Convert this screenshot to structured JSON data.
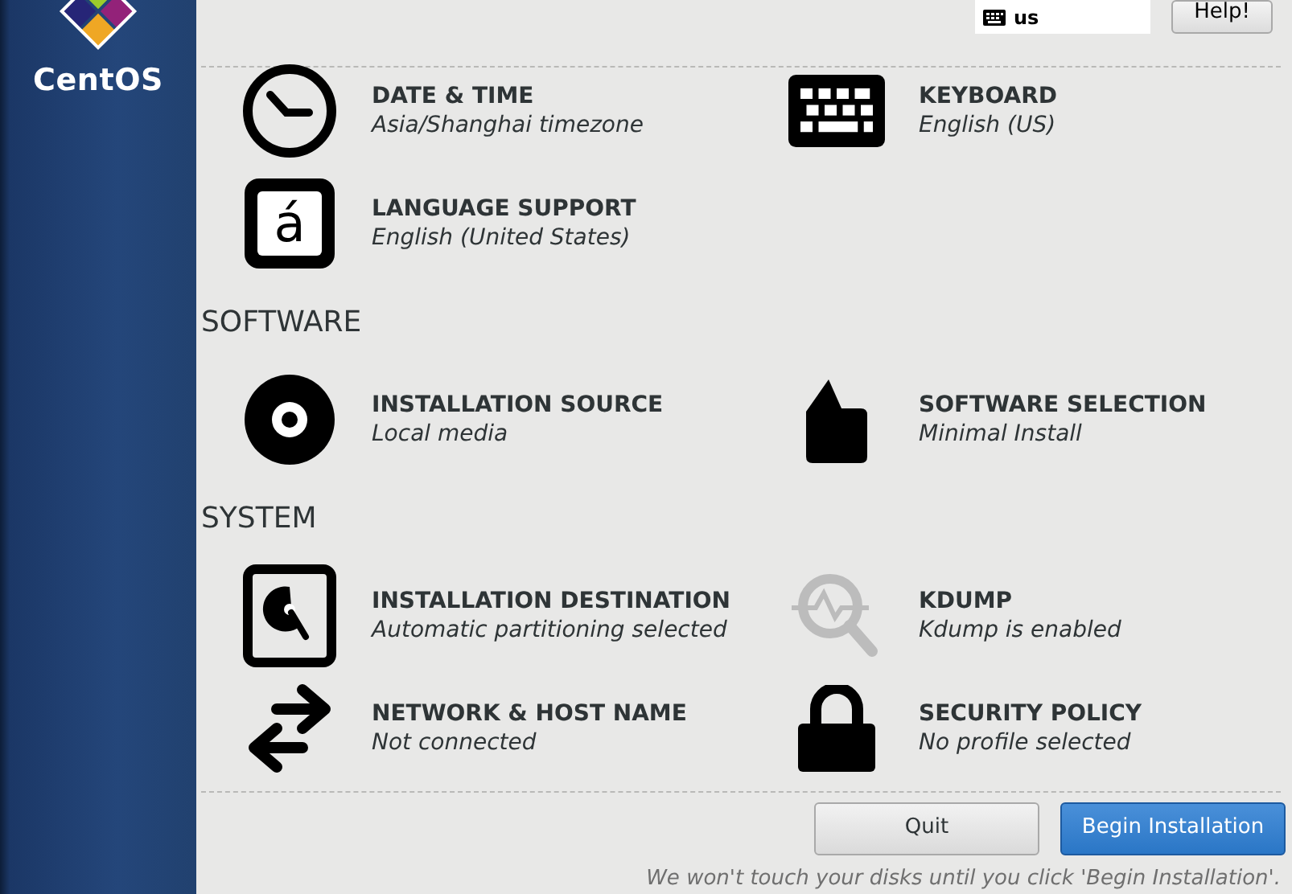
{
  "sidebar": {
    "logo_text": "CentOS"
  },
  "keyboard_layout": {
    "value": "us"
  },
  "help_button": "Help!",
  "sections": [
    {
      "spokes": [
        {
          "title": "DATE & TIME",
          "status": "Asia/Shanghai timezone"
        },
        {
          "title": "KEYBOARD",
          "status": "English (US)"
        },
        {
          "glyph": "á",
          "title": "LANGUAGE SUPPORT",
          "status": "English (United States)"
        }
      ]
    },
    {
      "title": "SOFTWARE",
      "spokes": [
        {
          "title": "INSTALLATION SOURCE",
          "status": "Local media"
        },
        {
          "title": "SOFTWARE SELECTION",
          "status": "Minimal Install"
        }
      ]
    },
    {
      "title": "SYSTEM",
      "spokes": [
        {
          "title": "INSTALLATION DESTINATION",
          "status": "Automatic partitioning selected"
        },
        {
          "title": "KDUMP",
          "status": "Kdump is enabled"
        },
        {
          "title": "NETWORK & HOST NAME",
          "status": "Not connected"
        },
        {
          "title": "SECURITY POLICY",
          "status": "No profile selected"
        }
      ]
    }
  ],
  "buttons": [
    {
      "kind": "secondary",
      "label": "Quit"
    },
    {
      "kind": "primary",
      "label": "Begin Installation"
    }
  ],
  "footer_note": "We won't touch your disks until you click 'Begin Installation'."
}
